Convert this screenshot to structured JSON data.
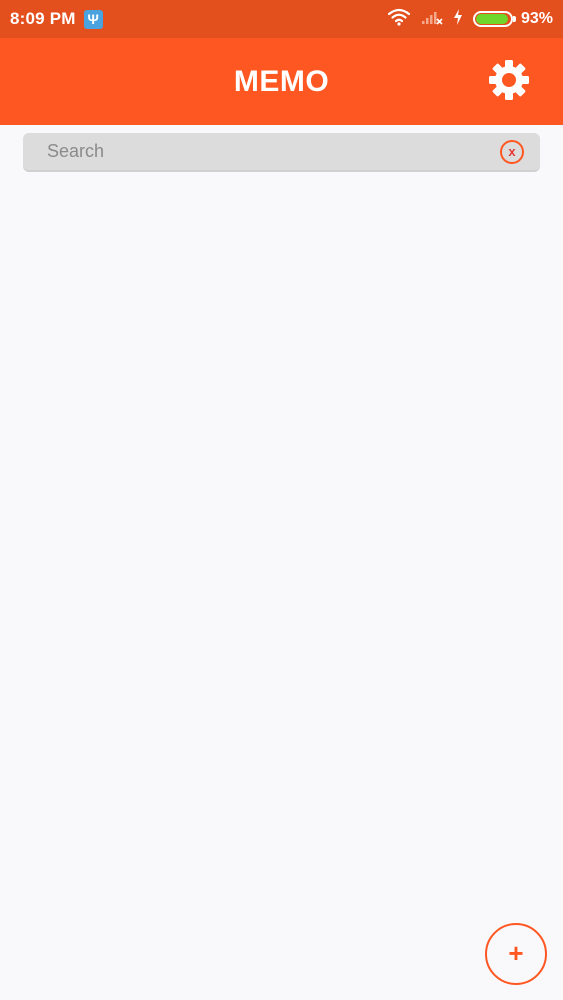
{
  "status_bar": {
    "time": "8:09 PM",
    "usb_glyph": "Ψ",
    "battery_percent": "93%",
    "battery_level": 0.93,
    "icons": [
      "wifi-icon",
      "signal-icon",
      "charging-icon",
      "battery-icon"
    ]
  },
  "app_bar": {
    "title": "MEMO",
    "settings_icon": "gear-icon"
  },
  "search": {
    "placeholder": "Search",
    "value": "",
    "clear_label": "x"
  },
  "memos": [],
  "fab": {
    "label": "+",
    "icon": "plus-icon"
  },
  "colors": {
    "status_bar": "#e34f1d",
    "app_bar": "#ff5722",
    "accent": "#ff5722",
    "background": "#f9f8fa",
    "search_bg": "#dcdcdc",
    "battery_fill": "#6fd62b"
  }
}
